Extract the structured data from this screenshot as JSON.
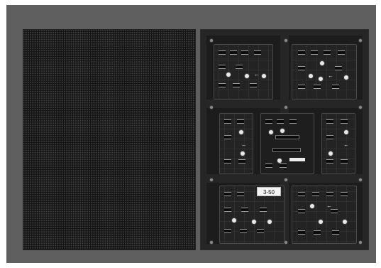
{
  "photo": {
    "background": "#5f5f5f",
    "front": {
      "name": "led-module-front",
      "pixel_color": "#3d3d3d",
      "base_color": "#121212"
    },
    "back": {
      "name": "led-module-back",
      "sticker_text": "3-50",
      "arrow_glyph": "←"
    }
  }
}
